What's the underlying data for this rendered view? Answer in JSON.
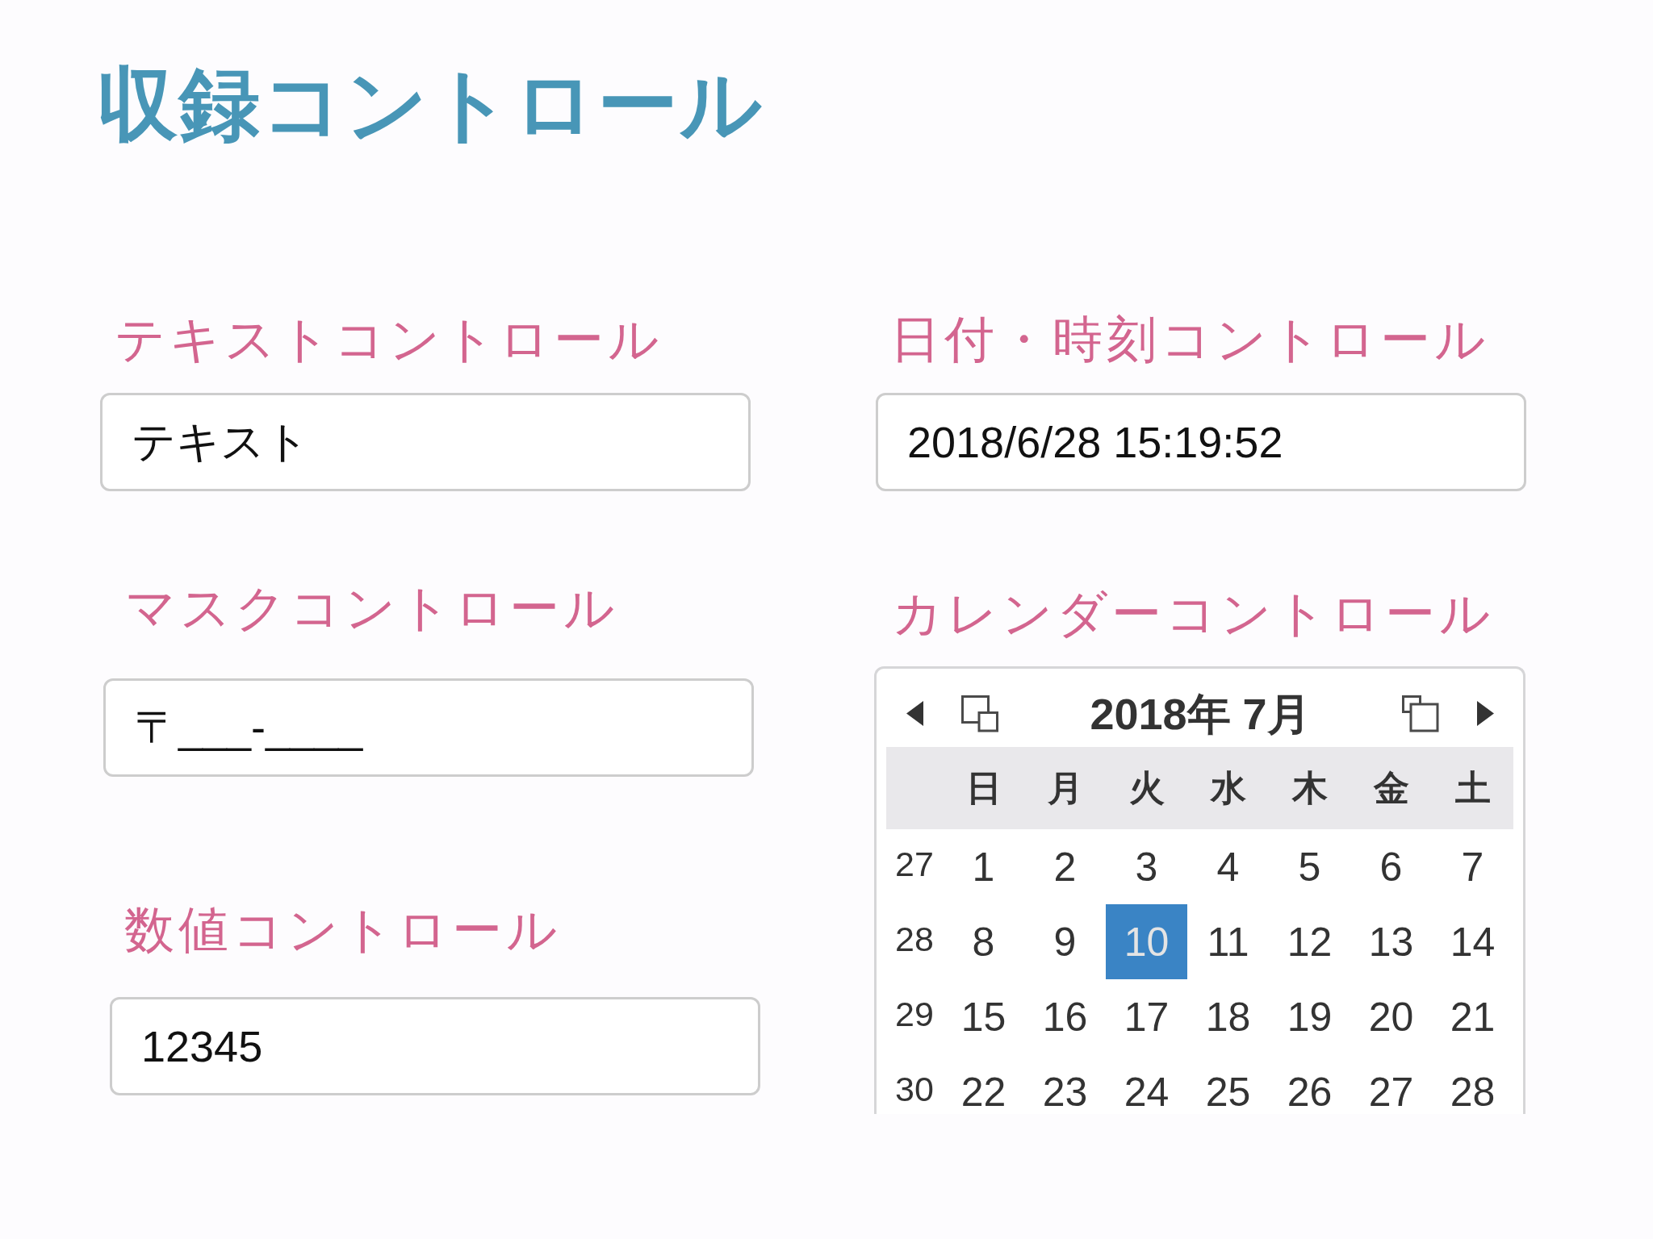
{
  "title": "収録コントロール",
  "left_controls": [
    {
      "kind": "text",
      "label": "テキストコントロール",
      "value": "テキスト"
    },
    {
      "kind": "mask",
      "label": "マスクコントロール",
      "value": "〒___-____"
    },
    {
      "kind": "number",
      "label": "数値コントロール",
      "value": "12345"
    }
  ],
  "right_controls": [
    {
      "kind": "datetime",
      "label": "日付・時刻コントロール",
      "value": "2018/6/28 15:19:52"
    },
    {
      "kind": "calendar",
      "label": "カレンダーコントロール",
      "month_title": "2018年 7月",
      "weekdays": [
        "日",
        "月",
        "火",
        "水",
        "木",
        "金",
        "土"
      ],
      "weeks": [
        {
          "week_number": "27",
          "days": [
            {
              "day": "1",
              "selected": false
            },
            {
              "day": "2",
              "selected": false
            },
            {
              "day": "3",
              "selected": false
            },
            {
              "day": "4",
              "selected": false
            },
            {
              "day": "5",
              "selected": false
            },
            {
              "day": "6",
              "selected": false
            },
            {
              "day": "7",
              "selected": false
            }
          ]
        },
        {
          "week_number": "28",
          "days": [
            {
              "day": "8",
              "selected": false
            },
            {
              "day": "9",
              "selected": false
            },
            {
              "day": "10",
              "selected": true
            },
            {
              "day": "11",
              "selected": false
            },
            {
              "day": "12",
              "selected": false
            },
            {
              "day": "13",
              "selected": false
            },
            {
              "day": "14",
              "selected": false
            }
          ]
        },
        {
          "week_number": "29",
          "days": [
            {
              "day": "15",
              "selected": false
            },
            {
              "day": "16",
              "selected": false
            },
            {
              "day": "17",
              "selected": false
            },
            {
              "day": "18",
              "selected": false
            },
            {
              "day": "19",
              "selected": false
            },
            {
              "day": "20",
              "selected": false
            },
            {
              "day": "21",
              "selected": false
            }
          ]
        },
        {
          "week_number": "30",
          "days": [
            {
              "day": "22",
              "selected": false
            },
            {
              "day": "23",
              "selected": false
            },
            {
              "day": "24",
              "selected": false
            },
            {
              "day": "25",
              "selected": false
            },
            {
              "day": "26",
              "selected": false
            },
            {
              "day": "27",
              "selected": false
            },
            {
              "day": "28",
              "selected": false
            }
          ]
        }
      ]
    }
  ]
}
